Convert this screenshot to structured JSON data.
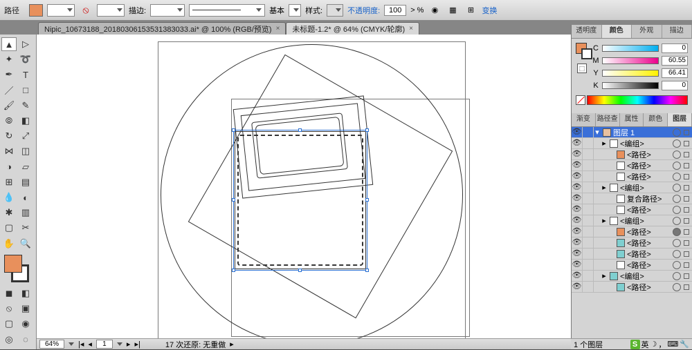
{
  "topbar": {
    "path_label": "路径",
    "fill_color": "#e8905c",
    "stroke_label": "描边:",
    "stroke_value": "",
    "basic_label": "基本",
    "style_label": "样式:",
    "opacity_label": "不透明度:",
    "opacity_value": "100",
    "opacity_suffix": "> %",
    "transform_link": "变换"
  },
  "docs": {
    "tab1": "Nipic_10673188_20180306153531383033.ai* @ 100% (RGB/预览)",
    "tab2": "未标题-1.2* @ 64% (CMYK/轮廓)"
  },
  "color_panel": {
    "tabs": {
      "transparency": "透明度",
      "color": "颜色",
      "appearance": "外观",
      "stroke": "描边"
    },
    "c": {
      "label": "C",
      "value": "0"
    },
    "m": {
      "label": "M",
      "value": "60.55"
    },
    "y": {
      "label": "Y",
      "value": "66.41"
    },
    "k": {
      "label": "K",
      "value": "0"
    }
  },
  "layers_panel": {
    "tabs": {
      "gradient": "渐变",
      "pathfinder": "路径查",
      "attributes": "属性",
      "color": "颜色",
      "layers": "图层"
    },
    "items": [
      {
        "name": "图层 1",
        "indent": 0,
        "selected": true,
        "disclose": "▾",
        "thumb": "#e8c0a0",
        "targetFill": "#3a6fd8"
      },
      {
        "name": "<编组>",
        "indent": 1,
        "disclose": "▸",
        "thumb": "#fff"
      },
      {
        "name": "<路径>",
        "indent": 2,
        "thumb": "#e8905c"
      },
      {
        "name": "<路径>",
        "indent": 2,
        "thumb": "#fff"
      },
      {
        "name": "<路径>",
        "indent": 2,
        "thumb": "#fff"
      },
      {
        "name": "<编组>",
        "indent": 1,
        "disclose": "▸",
        "thumb": "#fff"
      },
      {
        "name": "复合路径>",
        "indent": 2,
        "thumb": "#fff"
      },
      {
        "name": "<路径>",
        "indent": 2,
        "thumb": "#fff"
      },
      {
        "name": "<编组>",
        "indent": 1,
        "disclose": "▸",
        "thumb": "#fff"
      },
      {
        "name": "<路径>",
        "indent": 2,
        "thumb": "#e8905c",
        "targetFill": "#777"
      },
      {
        "name": "<路径>",
        "indent": 2,
        "thumb": "#7fcfd0"
      },
      {
        "name": "<路径>",
        "indent": 2,
        "thumb": "#7fcfd0"
      },
      {
        "name": "<路径>",
        "indent": 2,
        "thumb": "#fff"
      },
      {
        "name": "<编组>",
        "indent": 1,
        "disclose": "▸",
        "thumb": "#7fcfd0"
      },
      {
        "name": "<路径>",
        "indent": 2,
        "thumb": "#7fcfd0"
      }
    ],
    "footer": "1 个图层"
  },
  "statusbar": {
    "zoom": "64%",
    "page": "1",
    "undo_label": "17 次还原: 无重做"
  },
  "ime": {
    "badge": "S",
    "lang": "英"
  }
}
